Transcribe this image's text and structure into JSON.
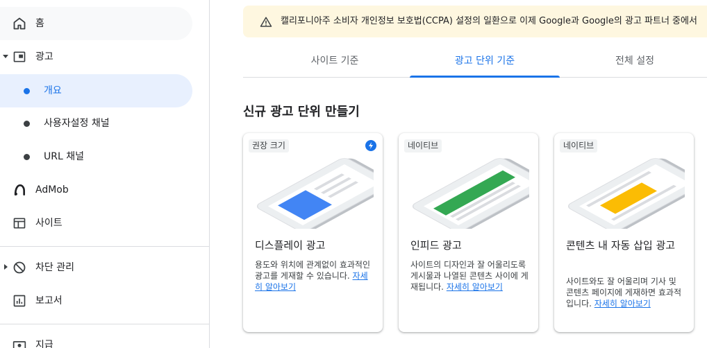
{
  "sidebar": {
    "items": [
      {
        "label": "홈",
        "icon": "home-icon"
      },
      {
        "label": "광고",
        "icon": "ads-icon"
      },
      {
        "label": "개요"
      },
      {
        "label": "사용자설정 채널"
      },
      {
        "label": "URL 채널"
      },
      {
        "label": "AdMob",
        "icon": "admob-icon"
      },
      {
        "label": "사이트",
        "icon": "sites-icon"
      },
      {
        "label": "차단 관리",
        "icon": "block-icon"
      },
      {
        "label": "보고서",
        "icon": "reports-icon"
      },
      {
        "label": "지급",
        "icon": "payments-icon"
      }
    ]
  },
  "banner": {
    "icon": "warning-icon",
    "text": "캘리포니아주 소비자 개인정보 보호법(CCPA) 설정의 일환으로 이제 Google과 Google의 광고 파트너 중에서"
  },
  "tabs": [
    {
      "label": "사이트 기준"
    },
    {
      "label": "광고 단위 기준"
    },
    {
      "label": "전체 설정"
    }
  ],
  "section_title": "신규 광고 단위 만들기",
  "cards": [
    {
      "chip": "권장 크기",
      "title": "디스플레이 광고",
      "desc": "용도와 위치에 관계없이 효과적인 광고를 게재할 수 있습니다.",
      "link": "자세히 알아보기",
      "illus_color": "#4285f4"
    },
    {
      "chip": "네이티브",
      "title": "인피드 광고",
      "desc": "사이트의 디자인과 잘 어울리도록 게시물과 나열된 콘텐츠 사이에 게재됩니다.",
      "link": "자세히 알아보기",
      "illus_color": "#34a853"
    },
    {
      "chip": "네이티브",
      "title": "콘텐츠 내 자동 삽입 광고",
      "desc": "사이트와도 잘 어울리며 기사 및 콘텐츠 페이지에 게재하면 효과적입니다.",
      "link": "자세히 알아보기",
      "illus_color": "#fbbc04"
    }
  ]
}
